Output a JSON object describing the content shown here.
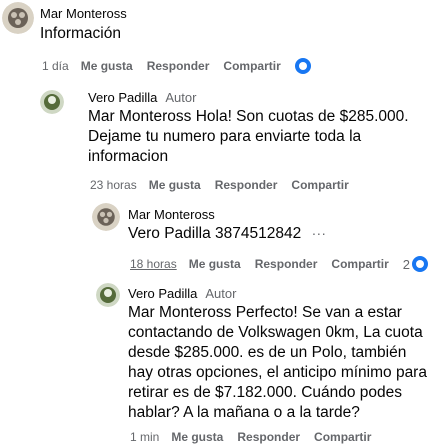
{
  "comments": [
    {
      "author": "Mar Monteross",
      "text": "Información",
      "time": "1 día",
      "actions": [
        "Me gusta",
        "Responder",
        "Compartir"
      ]
    },
    {
      "author": "Vero Padilla",
      "badge": "Autor",
      "mention": "Mar Monteross",
      "text": "Hola! Son cuotas de $285.000. Dejame tu numero para enviarte toda la informacion",
      "time": "23 horas",
      "actions": [
        "Me gusta",
        "Responder",
        "Compartir"
      ]
    },
    {
      "author": "Mar Monteross",
      "mention": "Vero Padilla",
      "text": "3874512842",
      "time": "18 horas",
      "actions": [
        "Me gusta",
        "Responder",
        "Compartir"
      ],
      "reaction_count": "2",
      "more": "..."
    },
    {
      "author": "Vero Padilla",
      "badge": "Autor",
      "mention": "Mar Monteross",
      "text": "Perfecto! Se van a estar contactando de Volkswagen 0km, La cuota desde $285.000. es de un Polo, también hay otras opciones, el anticipo mínimo para retirar es de $7.182.000. Cuándo podes hablar? A la mañana o a la tarde?",
      "time": "1 min",
      "actions": [
        "Me gusta",
        "Responder",
        "Compartir"
      ]
    }
  ],
  "colors": {
    "bubble": "#f0f2f5",
    "meta": "#65676b",
    "accent": "#1877f2"
  }
}
